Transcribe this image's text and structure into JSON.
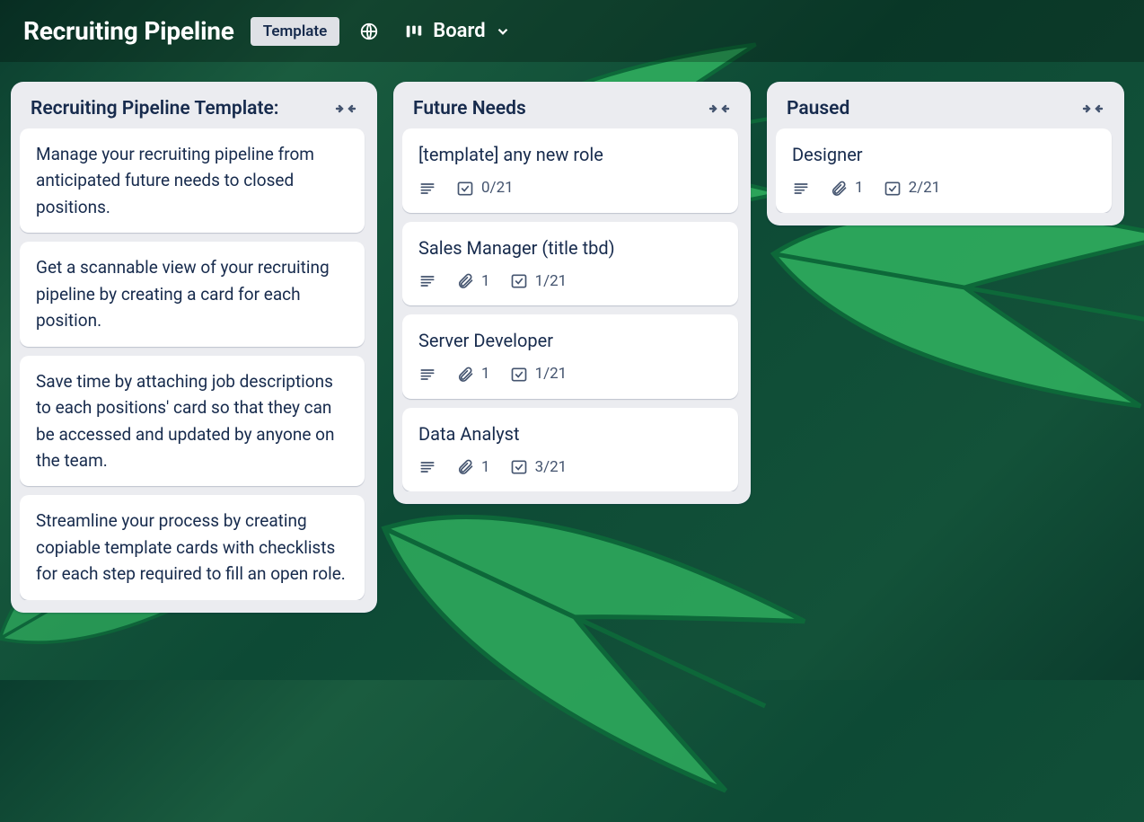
{
  "header": {
    "title": "Recruiting Pipeline",
    "template_badge": "Template",
    "view_label": "Board"
  },
  "lists": [
    {
      "title": "Recruiting Pipeline Template:",
      "cards": [
        {
          "type": "text",
          "text": "Manage your recruiting pipeline from anticipated future needs to closed positions."
        },
        {
          "type": "text",
          "text": "Get a scannable view of your recruiting pipeline by creating a card for each position."
        },
        {
          "type": "text",
          "text": "Save time by attaching job descriptions to each positions' card so that they can be accessed and updated by anyone on the team."
        },
        {
          "type": "text",
          "text": "Streamline your process by creating copiable template cards with checklists for each step required to fill an open role."
        }
      ]
    },
    {
      "title": "Future Needs",
      "cards": [
        {
          "type": "role",
          "title": "[template] any new role",
          "has_desc": true,
          "attachments": null,
          "checklist": "0/21"
        },
        {
          "type": "role",
          "title": "Sales Manager (title tbd)",
          "has_desc": true,
          "attachments": "1",
          "checklist": "1/21"
        },
        {
          "type": "role",
          "title": "Server Developer",
          "has_desc": true,
          "attachments": "1",
          "checklist": "1/21"
        },
        {
          "type": "role",
          "title": "Data Analyst",
          "has_desc": true,
          "attachments": "1",
          "checklist": "3/21"
        }
      ]
    },
    {
      "title": "Paused",
      "cards": [
        {
          "type": "role",
          "title": "Designer",
          "has_desc": true,
          "attachments": "1",
          "checklist": "2/21"
        }
      ]
    }
  ]
}
